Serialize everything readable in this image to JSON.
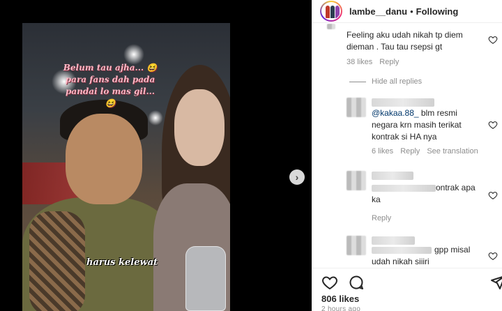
{
  "media": {
    "overlay_line1": "Belum tau ajha... 😆",
    "overlay_line2": "para fans dah pada",
    "overlay_line3": "pandai lo mas gil...",
    "overlay_line4": "😆",
    "overlay_bottom": "harus kelewat",
    "next_icon": "chevron-right-icon"
  },
  "header": {
    "username": "lambe__danu",
    "separator": "•",
    "follow_status": "Following"
  },
  "comments": [
    {
      "text_line1": "Feeling aku udah nikah tp diem",
      "text_line2": "dieman . Tau tau rsepsi gt",
      "likes": "38 likes",
      "reply": "Reply"
    }
  ],
  "hide_replies": "Hide all replies",
  "replies": [
    {
      "mention": "@kakaa.88_",
      "text_line1": " blm resmi",
      "text_line2": "negara krn masih terikat",
      "text_line3": "kontrak si HA nya",
      "likes": "6 likes",
      "reply": "Reply",
      "translate": "See translation"
    },
    {
      "text_line1": "ontrak apa",
      "text_line2": "ka",
      "reply": "Reply"
    },
    {
      "text_line1": "gpp misal",
      "text_line2": "udah nikah siiiri"
    }
  ],
  "footer": {
    "likes": "806 likes",
    "time": "2 hours ago"
  }
}
